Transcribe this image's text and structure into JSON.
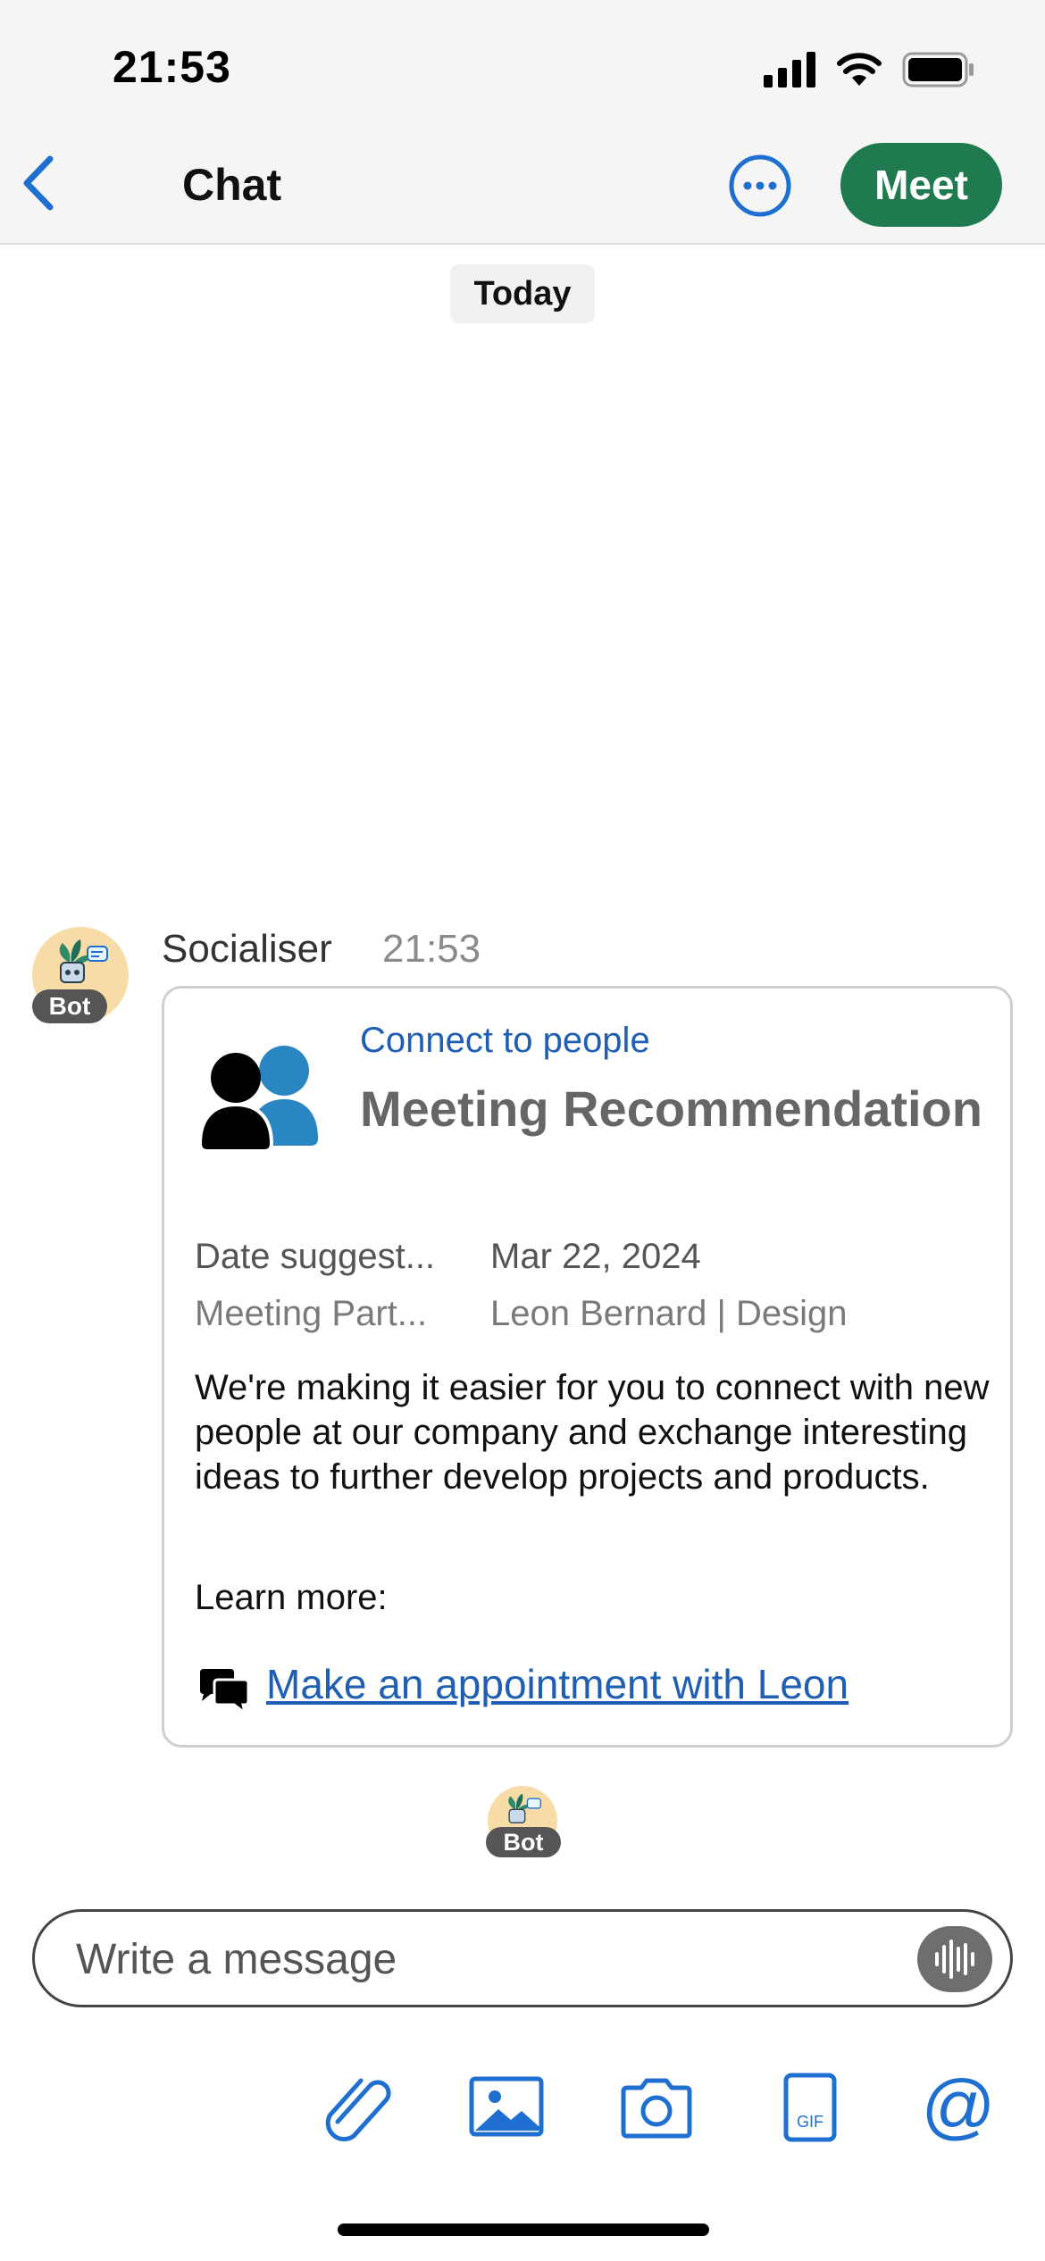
{
  "status_bar": {
    "time": "21:53"
  },
  "nav": {
    "title": "Chat",
    "meet_label": "Meet"
  },
  "day_separator": "Today",
  "message": {
    "sender": "Socialiser",
    "time": "21:53",
    "avatar_badge": "Bot",
    "card": {
      "subtitle": "Connect to people",
      "title": "Meeting Recommendation",
      "facts": [
        {
          "label": "Date suggest...",
          "value": "Mar 22, 2024"
        },
        {
          "label": "Meeting Part...",
          "value": "Leon Bernard | Design"
        }
      ],
      "body": "We're making it easier for you to connect with new people at our company and exchange interesting ideas to further develop projects and products.",
      "learn_more": "Learn more:",
      "link_text": "Make an appointment with Leon"
    }
  },
  "typing_avatar_badge": "Bot",
  "composer": {
    "placeholder": "Write a message",
    "value": ""
  },
  "toolbar": [
    "paperclip-icon",
    "image-icon",
    "camera-icon",
    "gif-icon",
    "at-icon"
  ],
  "colors": {
    "accent": "#1e5fb3",
    "meet_button": "#1f7a50",
    "avatar_bg": "#f7dca8"
  }
}
